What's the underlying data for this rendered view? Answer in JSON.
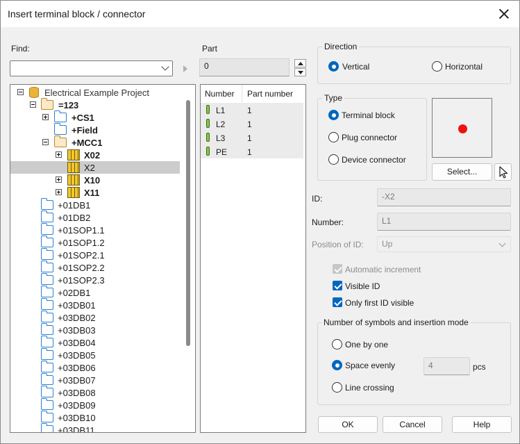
{
  "window": {
    "title": "Insert terminal block / connector"
  },
  "find": {
    "label": "Find:",
    "value": ""
  },
  "part": {
    "label": "Part",
    "value": "0"
  },
  "tree": {
    "items": [
      {
        "label": "Electrical Example Project",
        "bold": false
      },
      {
        "label": "=123",
        "bold": true
      },
      {
        "label": "+CS1",
        "bold": true
      },
      {
        "label": "+Field",
        "bold": true
      },
      {
        "label": "+MCC1",
        "bold": true
      },
      {
        "label": "X02",
        "bold": true
      },
      {
        "label": "X2",
        "bold": false,
        "selected": true
      },
      {
        "label": "X10",
        "bold": true
      },
      {
        "label": "X11",
        "bold": true
      },
      {
        "label": "+01DB1"
      },
      {
        "label": "+01DB2"
      },
      {
        "label": "+01SOP1.1"
      },
      {
        "label": "+01SOP1.2"
      },
      {
        "label": "+01SOP2.1"
      },
      {
        "label": "+01SOP2.2"
      },
      {
        "label": "+01SOP2.3"
      },
      {
        "label": "+02DB1"
      },
      {
        "label": "+03DB01"
      },
      {
        "label": "+03DB02"
      },
      {
        "label": "+03DB03"
      },
      {
        "label": "+03DB04"
      },
      {
        "label": "+03DB05"
      },
      {
        "label": "+03DB06"
      },
      {
        "label": "+03DB07"
      },
      {
        "label": "+03DB08"
      },
      {
        "label": "+03DB09"
      },
      {
        "label": "+03DB10"
      },
      {
        "label": "+03DB11"
      }
    ]
  },
  "list": {
    "columns": [
      "Number",
      "Part number"
    ],
    "rows": [
      {
        "number": "L1",
        "part_number": "1"
      },
      {
        "number": "L2",
        "part_number": "1"
      },
      {
        "number": "L3",
        "part_number": "1"
      },
      {
        "number": "PE",
        "part_number": "1"
      }
    ]
  },
  "direction": {
    "label": "Direction",
    "vertical": "Vertical",
    "horizontal": "Horizontal",
    "selected": "vertical"
  },
  "type": {
    "label": "Type",
    "terminal_block": "Terminal block",
    "plug_connector": "Plug connector",
    "device_connector": "Device connector",
    "selected": "terminal_block"
  },
  "select_button": "Select...",
  "id": {
    "label": "ID:",
    "value": "-X2"
  },
  "number": {
    "label": "Number:",
    "value": "L1"
  },
  "position_of_id": {
    "label": "Position of ID:",
    "value": "Up"
  },
  "options": {
    "automatic_increment": "Automatic increment",
    "visible_id": "Visible ID",
    "only_first_id_visible": "Only first ID visible"
  },
  "insertion": {
    "label": "Number of symbols and insertion mode",
    "one_by_one": "One by one",
    "space_evenly": "Space evenly",
    "line_crossing": "Line crossing",
    "count": "4",
    "unit": "pcs",
    "selected": "space_evenly"
  },
  "buttons": {
    "ok": "OK",
    "cancel": "Cancel",
    "help": "Help"
  },
  "colors": {
    "accent": "#0067c0",
    "preview_dot": "#ee1111"
  }
}
